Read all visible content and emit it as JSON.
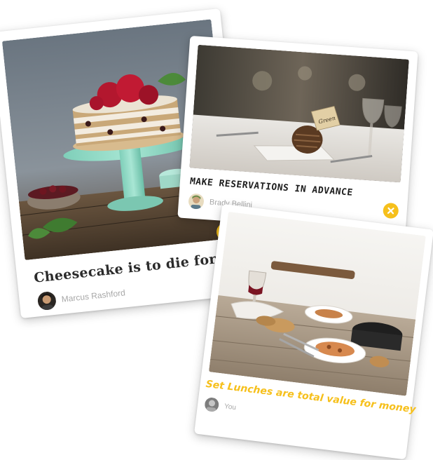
{
  "cards": [
    {
      "caption": "Cheesecake is to die for",
      "author": "Marcus Rashford",
      "badge": "check"
    },
    {
      "caption": "MAKE RESERVATIONS IN ADVANCE",
      "author": "Brady Bellini",
      "badge": "close",
      "place_card_text": "Green"
    },
    {
      "caption": "Set Lunches are total value for money",
      "author": "You"
    }
  ],
  "colors": {
    "accent": "#f6c01c",
    "caption_dark": "#2b2b2b",
    "author_gray": "#a8a8a8",
    "card_bg": "#ffffff"
  }
}
